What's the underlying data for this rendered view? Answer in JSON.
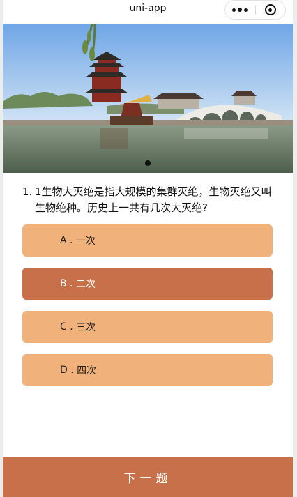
{
  "navbar": {
    "title": "uni-app",
    "more_icon": "more-dots-icon",
    "close_icon": "target-circle-icon"
  },
  "banner": {
    "image": "pagoda-lake-bridge-photo",
    "page_indicator": {
      "count": 1,
      "active": 1
    }
  },
  "question": {
    "number": "1.",
    "text": "1生物大灭绝是指大规模的集群灭绝，生物灭绝又叫生物绝种。历史上一共有几次大灭绝?"
  },
  "options": [
    {
      "letter": "A",
      "text": "一次",
      "selected": false
    },
    {
      "letter": "B",
      "text": "二次",
      "selected": true
    },
    {
      "letter": "C",
      "text": "三次",
      "selected": false
    },
    {
      "letter": "D",
      "text": "四次",
      "selected": false
    }
  ],
  "next_button": {
    "label": "下一题"
  },
  "colors": {
    "option_bg": "#f0b27a",
    "option_selected_bg": "#c7704a",
    "button_bg": "#c7704a"
  }
}
